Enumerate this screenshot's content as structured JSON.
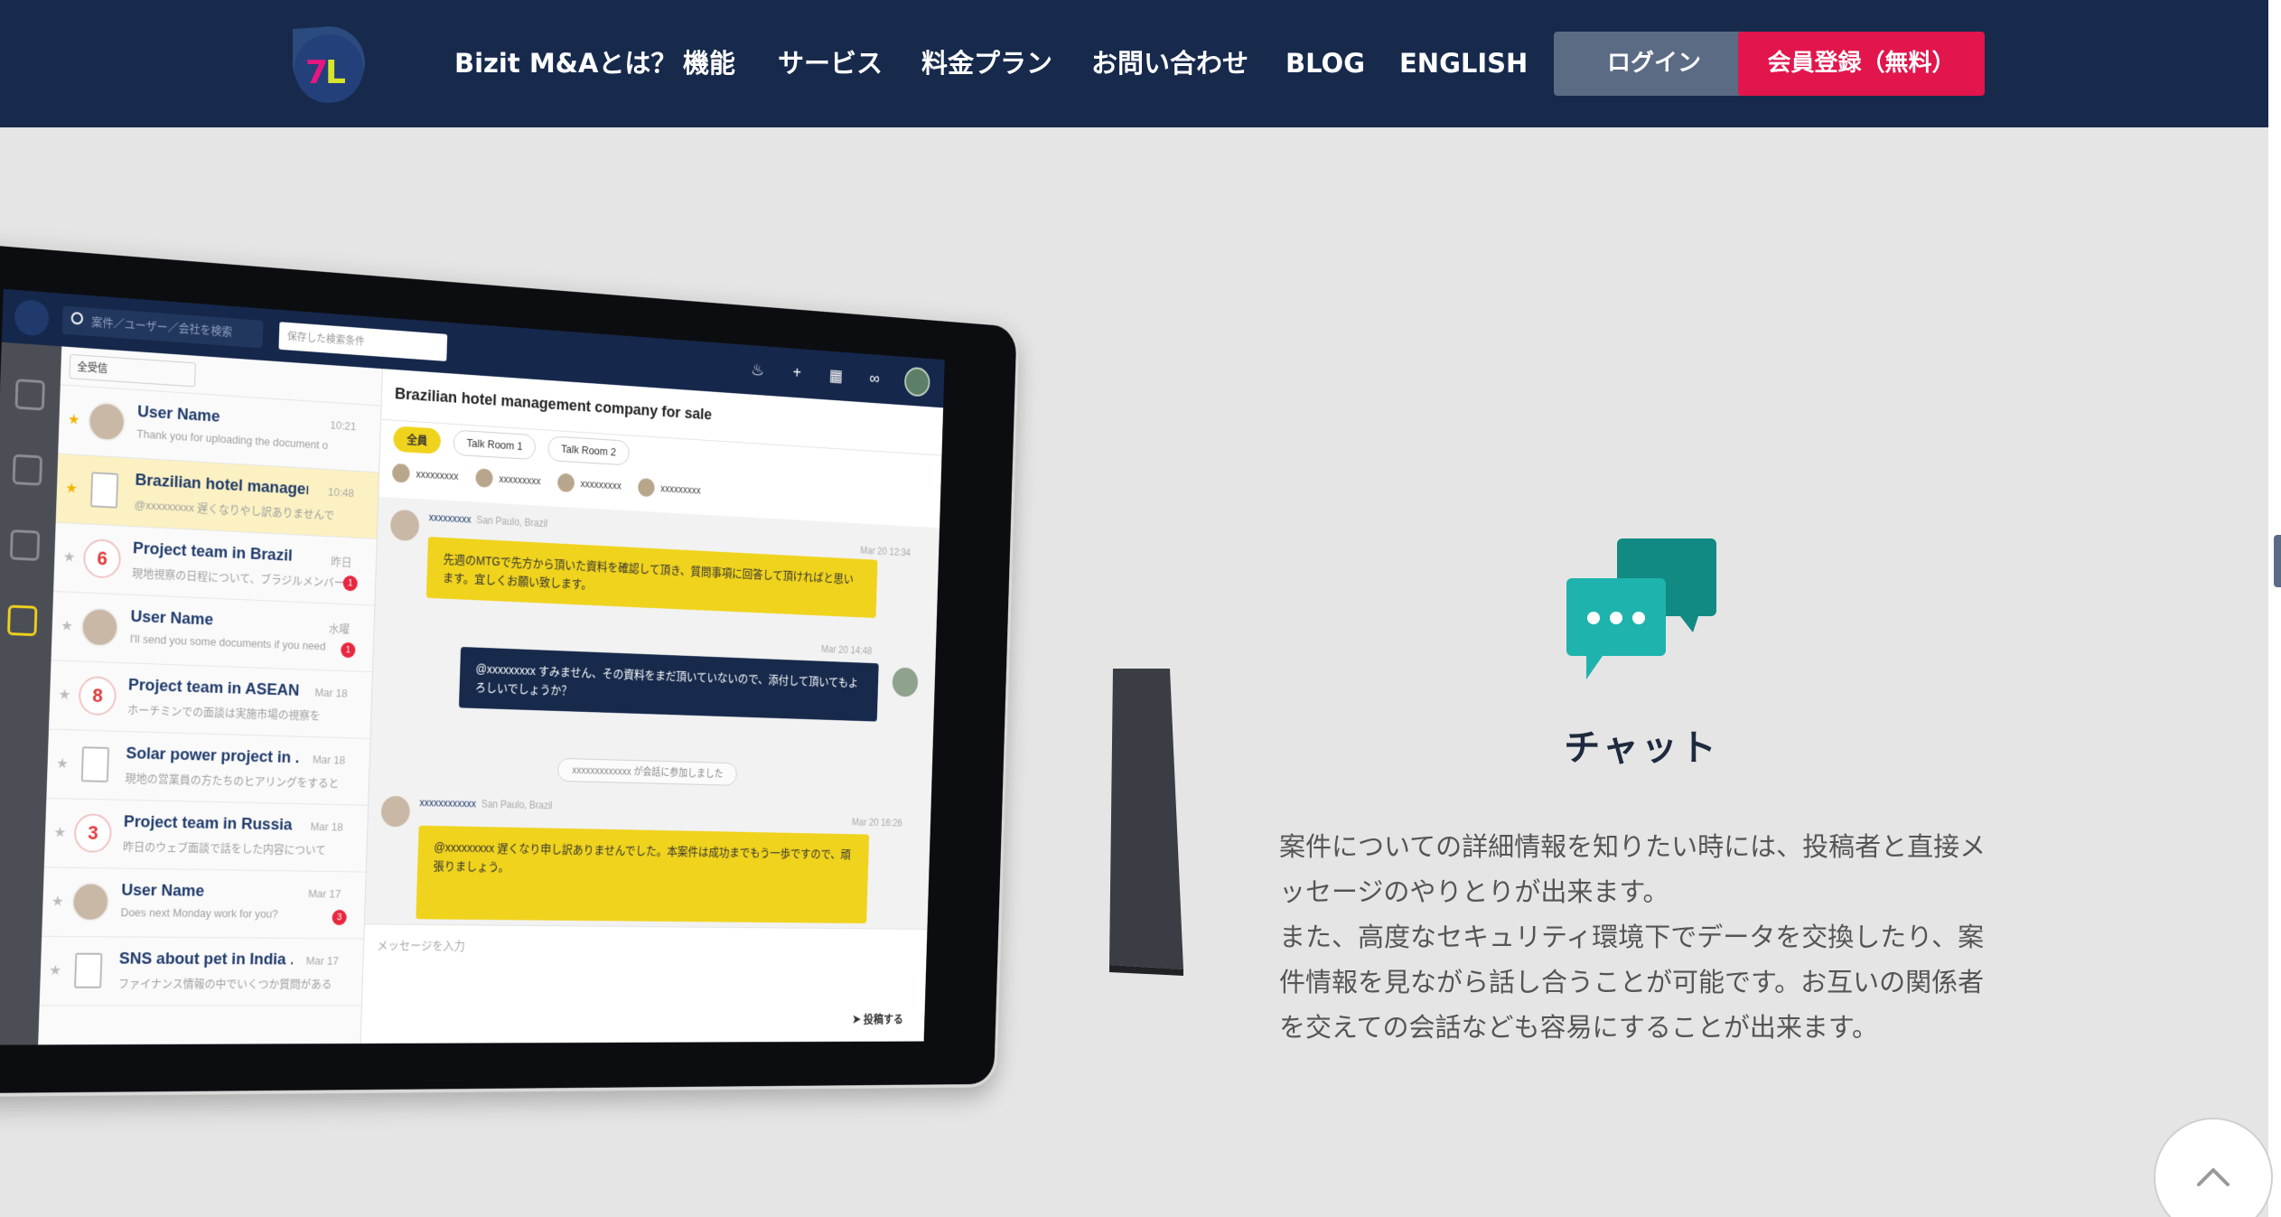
{
  "nav": {
    "links": [
      "Bizit M&Aとは？",
      "機能",
      "サービス",
      "料金プラン",
      "お問い合わせ",
      "BLOG",
      "ENGLISH"
    ],
    "login_label": "ログイン",
    "register_label": "会員登録（無料）"
  },
  "colors": {
    "nav_bg": "#172a4c",
    "page_bg": "#e5e5e5",
    "register": "#e2154c",
    "login": "#5b6b84",
    "chat_icon": "#16a8a2"
  },
  "feature": {
    "icon": "chat-bubbles-icon",
    "title": "チャット",
    "paragraph1": "案件についての詳細情報を知りたい時には、投稿者と直接メッセージのやりとりが出来ます。",
    "paragraph2": "また、高度なセキュリティ環境下でデータを交換したり、案件情報を見ながら話し合うことが可能です。お互いの関係者を交えての会話なども容易にすることが出来ます。"
  },
  "scroll_top_icon": "chevron-up-icon",
  "mock": {
    "search_placeholder": "案件／ユーザー／会社を検索",
    "saved_search": "保存した検索条件",
    "list_filter": "全受信",
    "conversations": [
      {
        "title": "User Name",
        "sub": "Thank you for uploading the document o",
        "time": "10:21",
        "kind": "avatar",
        "star": true
      },
      {
        "title": "Brazilian hotel managem...",
        "sub": "@xxxxxxxxx 遅くなりやし訳ありませんで",
        "time": "10:48",
        "kind": "doc",
        "star": true,
        "selected": true
      },
      {
        "title": "Project team in Brazil",
        "sub": "現地視察の日程について、ブラジルメンバー",
        "time": "昨日",
        "kind": "num",
        "num": "6",
        "badge": "1"
      },
      {
        "title": "User Name",
        "sub": "I'll send you some documents if you need",
        "time": "水曜",
        "kind": "avatar",
        "badge": "1"
      },
      {
        "title": "Project team in ASEAN",
        "sub": "ホーチミンでの面談は実施市場の視察を",
        "time": "Mar 18",
        "kind": "num",
        "num": "8"
      },
      {
        "title": "Solar power project in ...",
        "sub": "現地の営業員の方たちのヒアリングをすると",
        "time": "Mar 18",
        "kind": "doc"
      },
      {
        "title": "Project team in Russia",
        "sub": "昨日のウェブ面談で話をした内容について",
        "time": "Mar 18",
        "kind": "num",
        "num": "3"
      },
      {
        "title": "User Name",
        "sub": "Does next Monday work for you?",
        "time": "Mar 17",
        "kind": "avatar",
        "badge": "3"
      },
      {
        "title": "SNS about pet in India ...",
        "sub": "ファイナンス情報の中でいくつか質問がある",
        "time": "Mar 17",
        "kind": "doc"
      }
    ],
    "chat_title": "Brazilian hotel management company for sale",
    "tabs": [
      "全員",
      "Talk Room 1",
      "Talk Room 2"
    ],
    "members": [
      "xxxxxxxxx",
      "xxxxxxxxx",
      "xxxxxxxxx",
      "xxxxxxxxx"
    ],
    "messages": [
      {
        "author": "xxxxxxxxx",
        "place": "San Paulo, Brazil",
        "time": "Mar 20 12:34",
        "text": "先週のMTGで先方から頂いた資料を確認して頂き、質問事項に回答して頂ければと思います。宜しくお願い致します。"
      },
      {
        "author": "",
        "place": "",
        "time": "Mar 20 14:48",
        "text": "@xxxxxxxxx すみません、その資料をまだ頂いていないので、添付して頂いてもよろしいでしょうか？"
      },
      {
        "author": "xxxxxxxxxxxx",
        "place": "San Paulo, Brazil",
        "time": "Mar 20 16:26",
        "text": "@xxxxxxxxx 遅くなり申し訳ありませんでした。本案件は成功までもう一歩ですので、頑張りましょう。"
      }
    ],
    "system_note": "xxxxxxxxxxxxx が会話に参加しました",
    "compose_placeholder": "メッセージを入力",
    "send_label": "投稿する"
  }
}
